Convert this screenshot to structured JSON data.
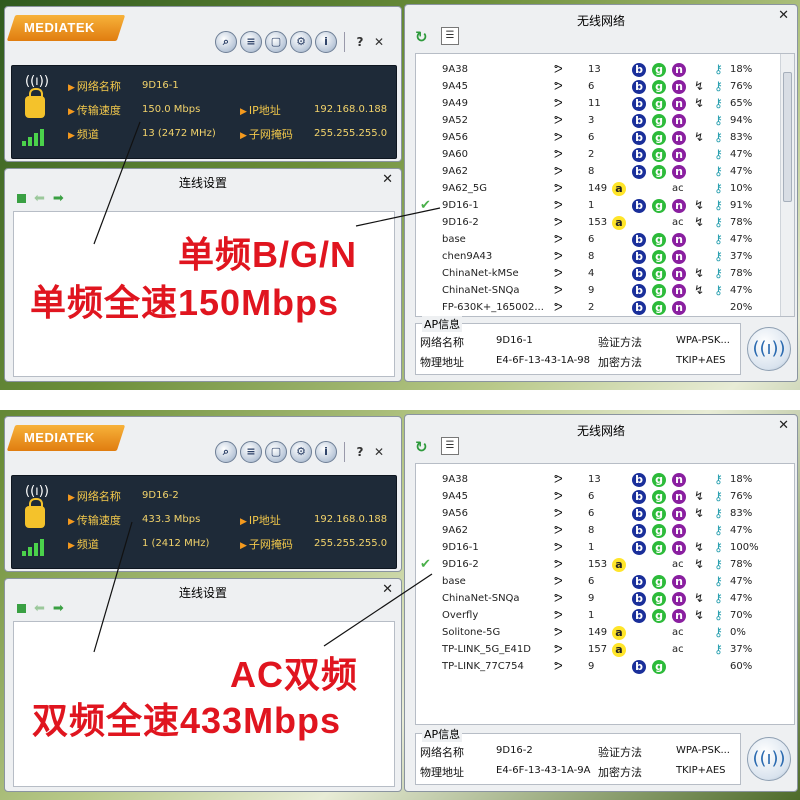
{
  "panels": [
    {
      "brand": "MEDIATEK",
      "toolbar_icons": [
        "search-icon",
        "list-icon",
        "document-icon",
        "gear-icon",
        "info-icon"
      ],
      "help_label": "?",
      "close_label": "✕",
      "status": {
        "network_name_label": "网络名称",
        "network_name": "9D16-1",
        "speed_label": "传输速度",
        "speed": "150.0 Mbps",
        "ip_label": "IP地址",
        "ip": "192.168.0.188",
        "channel_label": "频道",
        "channel": "13 (2472 MHz)",
        "mask_label": "子网掩码",
        "mask": "255.255.255.0"
      },
      "connection_title": "连线设置",
      "wireless_title": "无线网络",
      "networks": [
        {
          "ssid": "9A38",
          "ch": "13",
          "modes": [
            "b",
            "g",
            "n"
          ],
          "bonded": false,
          "key": true,
          "pct": "18%",
          "connected": false
        },
        {
          "ssid": "9A45",
          "ch": "6",
          "modes": [
            "b",
            "g",
            "n"
          ],
          "bonded": true,
          "key": true,
          "pct": "76%",
          "connected": false
        },
        {
          "ssid": "9A49",
          "ch": "11",
          "modes": [
            "b",
            "g",
            "n"
          ],
          "bonded": true,
          "key": true,
          "pct": "65%",
          "connected": false
        },
        {
          "ssid": "9A52",
          "ch": "3",
          "modes": [
            "b",
            "g",
            "n"
          ],
          "bonded": false,
          "key": true,
          "pct": "94%",
          "connected": false
        },
        {
          "ssid": "9A56",
          "ch": "6",
          "modes": [
            "b",
            "g",
            "n"
          ],
          "bonded": true,
          "key": true,
          "pct": "83%",
          "connected": false
        },
        {
          "ssid": "9A60",
          "ch": "2",
          "modes": [
            "b",
            "g",
            "n"
          ],
          "bonded": false,
          "key": true,
          "pct": "47%",
          "connected": false
        },
        {
          "ssid": "9A62",
          "ch": "8",
          "modes": [
            "b",
            "g",
            "n"
          ],
          "bonded": false,
          "key": true,
          "pct": "47%",
          "connected": false
        },
        {
          "ssid": "9A62_5G",
          "ch": "149",
          "modes": [
            "a",
            "ac"
          ],
          "bonded": false,
          "key": true,
          "pct": "10%",
          "connected": false
        },
        {
          "ssid": "9D16-1",
          "ch": "1",
          "modes": [
            "b",
            "g",
            "n"
          ],
          "bonded": true,
          "key": true,
          "pct": "91%",
          "connected": true
        },
        {
          "ssid": "9D16-2",
          "ch": "153",
          "modes": [
            "a",
            "ac"
          ],
          "bonded": true,
          "key": true,
          "pct": "78%",
          "connected": false
        },
        {
          "ssid": "base",
          "ch": "6",
          "modes": [
            "b",
            "g",
            "n"
          ],
          "bonded": false,
          "key": true,
          "pct": "47%",
          "connected": false
        },
        {
          "ssid": "chen9A43",
          "ch": "8",
          "modes": [
            "b",
            "g",
            "n"
          ],
          "bonded": false,
          "key": true,
          "pct": "37%",
          "connected": false
        },
        {
          "ssid": "ChinaNet-kMSe",
          "ch": "4",
          "modes": [
            "b",
            "g",
            "n"
          ],
          "bonded": true,
          "key": true,
          "pct": "78%",
          "connected": false
        },
        {
          "ssid": "ChinaNet-SNQa",
          "ch": "9",
          "modes": [
            "b",
            "g",
            "n"
          ],
          "bonded": true,
          "key": true,
          "pct": "47%",
          "connected": false
        },
        {
          "ssid": "FP-630K+_165002...",
          "ch": "2",
          "modes": [
            "b",
            "g",
            "n"
          ],
          "bonded": false,
          "key": false,
          "pct": "20%",
          "connected": false
        }
      ],
      "ap_info": {
        "legend": "AP信息",
        "name_label": "网络名称",
        "name": "9D16-1",
        "auth_label": "验证方法",
        "auth": "WPA-PSK...",
        "mac_label": "物理地址",
        "mac": "E4-6F-13-43-1A-98",
        "enc_label": "加密方法",
        "enc": "TKIP+AES"
      },
      "annotation_line1": "单频B/G/N",
      "annotation_line2": "单频全速150Mbps"
    },
    {
      "brand": "MEDIATEK",
      "toolbar_icons": [
        "search-icon",
        "list-icon",
        "document-icon",
        "gear-icon",
        "info-icon"
      ],
      "help_label": "?",
      "close_label": "✕",
      "status": {
        "network_name_label": "网络名称",
        "network_name": "9D16-2",
        "speed_label": "传输速度",
        "speed": "433.3 Mbps",
        "ip_label": "IP地址",
        "ip": "192.168.0.188",
        "channel_label": "频道",
        "channel": "1 (2412 MHz)",
        "mask_label": "子网掩码",
        "mask": "255.255.255.0"
      },
      "connection_title": "连线设置",
      "wireless_title": "无线网络",
      "networks": [
        {
          "ssid": "9A38",
          "ch": "13",
          "modes": [
            "b",
            "g",
            "n"
          ],
          "bonded": false,
          "key": true,
          "pct": "18%",
          "connected": false
        },
        {
          "ssid": "9A45",
          "ch": "6",
          "modes": [
            "b",
            "g",
            "n"
          ],
          "bonded": true,
          "key": true,
          "pct": "76%",
          "connected": false
        },
        {
          "ssid": "9A56",
          "ch": "6",
          "modes": [
            "b",
            "g",
            "n"
          ],
          "bonded": true,
          "key": true,
          "pct": "83%",
          "connected": false
        },
        {
          "ssid": "9A62",
          "ch": "8",
          "modes": [
            "b",
            "g",
            "n"
          ],
          "bonded": false,
          "key": true,
          "pct": "47%",
          "connected": false
        },
        {
          "ssid": "9D16-1",
          "ch": "1",
          "modes": [
            "b",
            "g",
            "n"
          ],
          "bonded": true,
          "key": true,
          "pct": "100%",
          "connected": false
        },
        {
          "ssid": "9D16-2",
          "ch": "153",
          "modes": [
            "a",
            "ac"
          ],
          "bonded": true,
          "key": true,
          "pct": "78%",
          "connected": true
        },
        {
          "ssid": "base",
          "ch": "6",
          "modes": [
            "b",
            "g",
            "n"
          ],
          "bonded": false,
          "key": true,
          "pct": "47%",
          "connected": false
        },
        {
          "ssid": "ChinaNet-SNQa",
          "ch": "9",
          "modes": [
            "b",
            "g",
            "n"
          ],
          "bonded": true,
          "key": true,
          "pct": "47%",
          "connected": false
        },
        {
          "ssid": "Overfly",
          "ch": "1",
          "modes": [
            "b",
            "g",
            "n"
          ],
          "bonded": true,
          "key": true,
          "pct": "70%",
          "connected": false
        },
        {
          "ssid": "Solitone-5G",
          "ch": "149",
          "modes": [
            "a",
            "ac"
          ],
          "bonded": false,
          "key": true,
          "pct": "0%",
          "connected": false
        },
        {
          "ssid": "TP-LINK_5G_E41D",
          "ch": "157",
          "modes": [
            "a",
            "ac"
          ],
          "bonded": false,
          "key": true,
          "pct": "37%",
          "connected": false
        },
        {
          "ssid": "TP-LINK_77C754",
          "ch": "9",
          "modes": [
            "b",
            "g"
          ],
          "bonded": false,
          "key": false,
          "pct": "60%",
          "connected": false
        }
      ],
      "ap_info": {
        "legend": "AP信息",
        "name_label": "网络名称",
        "name": "9D16-2",
        "auth_label": "验证方法",
        "auth": "WPA-PSK...",
        "mac_label": "物理地址",
        "mac": "E4-6F-13-43-1A-9A",
        "enc_label": "加密方法",
        "enc": "TKIP+AES"
      },
      "annotation_line1": "AC双频",
      "annotation_line2": "双频全速433Mbps"
    }
  ]
}
